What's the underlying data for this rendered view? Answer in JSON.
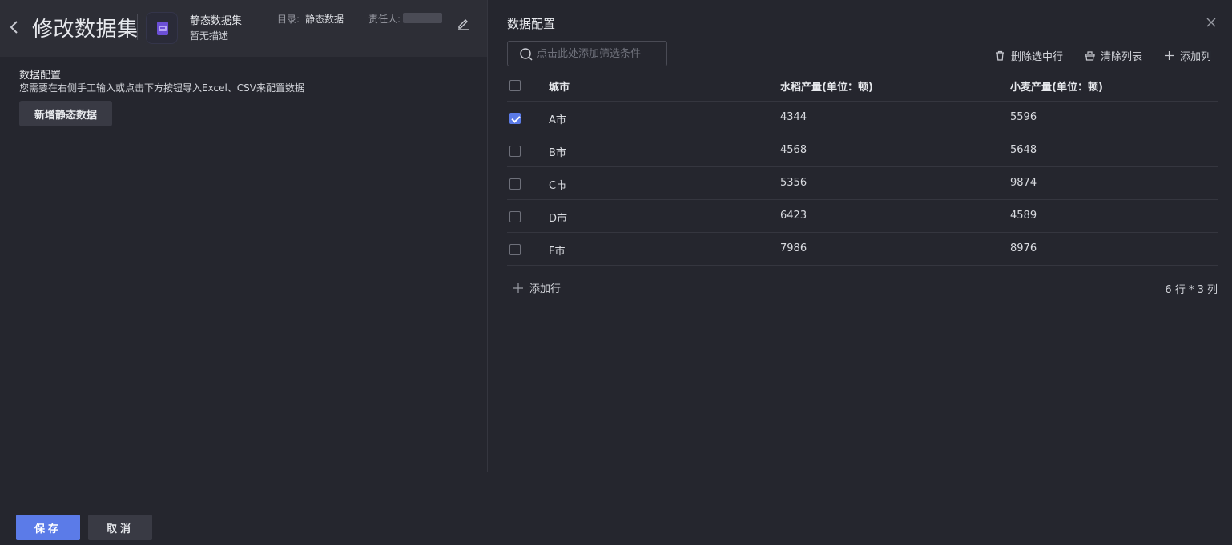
{
  "header": {
    "title": "修改数据集",
    "dataset_name": "静态数据集",
    "dataset_desc": "暂无描述",
    "dir_label": "目录:",
    "dir_value": "静态数据",
    "owner_label": "责任人:",
    "back_icon": "chevron-left-icon",
    "edit_icon": "pencil-icon",
    "dataset_icon": "file-icon"
  },
  "left": {
    "config_title": "数据配置",
    "config_hint": "您需要在右侧手工输入或点击下方按钮导入Excel、CSV来配置数据",
    "add_static_label": "新增静态数据"
  },
  "right": {
    "title": "数据配置",
    "search_placeholder": "点击此处添加筛选条件",
    "toolbar": {
      "delete_label": "删除选中行",
      "clear_label": "清除列表",
      "add_col_label": "添加列"
    },
    "columns": [
      "城市",
      "水稻产量(单位：顿)",
      "小麦产量(单位：顿)"
    ],
    "rows": [
      {
        "checked": true,
        "cells": [
          "A市",
          "4344",
          "5596"
        ]
      },
      {
        "checked": false,
        "cells": [
          "B市",
          "4568",
          "5648"
        ]
      },
      {
        "checked": false,
        "cells": [
          "C市",
          "5356",
          "9874"
        ]
      },
      {
        "checked": false,
        "cells": [
          "D市",
          "6423",
          "4589"
        ]
      },
      {
        "checked": false,
        "cells": [
          "F市",
          "7986",
          "8976"
        ]
      }
    ],
    "add_row_label": "添加行",
    "row_count": "6 行 * 3 列"
  },
  "footer": {
    "save_label": "保存",
    "cancel_label": "取消"
  },
  "colors": {
    "accent": "#5b7be8",
    "background": "#25262e",
    "header_bg": "#2d2e36"
  }
}
